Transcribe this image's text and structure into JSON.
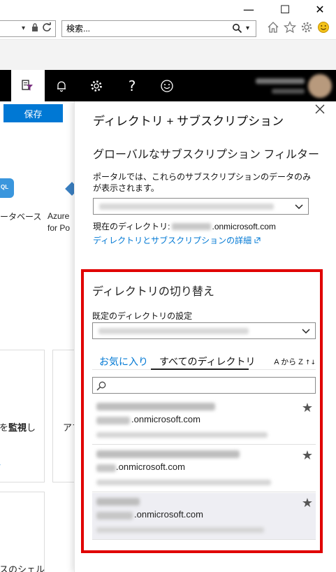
{
  "browser": {
    "window_controls": {
      "minimize": "—",
      "maximize": "☐",
      "close": "✕"
    },
    "address_bar": {
      "dropdown_glyph": "▾",
      "lock_icon": "lock-icon",
      "refresh_icon": "refresh-icon"
    },
    "search": {
      "placeholder": "検索...",
      "icon": "search-icon",
      "dropdown_glyph": "▾"
    },
    "toolbar_icons": [
      "home-icon",
      "favorites-star-icon",
      "settings-gear-icon",
      "feedback-smiley-icon"
    ]
  },
  "topnav": {
    "icons": [
      "directory-filter-icon",
      "notifications-bell-icon",
      "settings-gear-icon",
      "help-icon",
      "feedback-smiley-icon"
    ],
    "help_glyph": "?",
    "user": "blurred-user-account"
  },
  "left_blade": {
    "save_label": "保存",
    "tile_label_1": "ータベース",
    "tile_label_2a": "Azure",
    "tile_label_2b": "for Po",
    "monitor_label_prefix": "を",
    "monitor_label_bold": "監視",
    "monitor_label_suffix": "し",
    "app_label": "アプ",
    "shell_label": "スのシェル"
  },
  "panel": {
    "title": "ディレクトリ + サブスクリプション",
    "filter_heading": "グローバルなサブスクリプション フィルター",
    "filter_description": "ポータルでは、これらのサブスクリプションのデータのみが表示されます。",
    "current_directory_label": "現在のディレクトリ:",
    "current_directory_suffix": ".onmicrosoft.com",
    "details_link": "ディレクトリとサブスクリプションの詳細",
    "switch": {
      "heading": "ディレクトリの切り替え",
      "default_dir_label": "既定のディレクトリの設定",
      "tabs": [
        "お気に入り",
        "すべてのディレクトリ"
      ],
      "active_tab": "すべてのディレクトリ",
      "sort_label": "A から Z",
      "sort_glyph": "↑↓",
      "directories": [
        {
          "domain": ".onmicrosoft.com",
          "favorite": true,
          "selected": false
        },
        {
          "domain": ".onmicrosoft.com",
          "favorite": true,
          "selected": false
        },
        {
          "domain": ".onmicrosoft.com",
          "favorite": true,
          "selected": true
        }
      ],
      "star_glyph": "★"
    }
  },
  "colors": {
    "highlight": "#e00000",
    "accent": "#0078d4",
    "topnav": "#000000"
  }
}
